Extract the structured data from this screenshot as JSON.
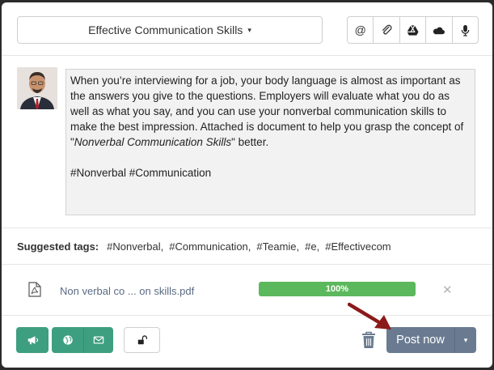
{
  "header": {
    "group_name": "Effective Communication Skills",
    "caret": "▾",
    "tools": [
      "at-icon",
      "paperclip-icon",
      "google-drive-icon",
      "onedrive-icon",
      "microphone-icon"
    ]
  },
  "post": {
    "text_before_italic": "When you’re interviewing for a job, your body language is almost as important as the answers you give to the questions. Employers will evaluate what you do as well as what you say, and you can use your nonverbal communication skills to make the best impression. Attached is document to help you grasp the concept of \"",
    "italic_text": "Nonverbal Communication Skills",
    "text_after_italic": "\" better.",
    "hashtags": "#Nonverbal #Communication"
  },
  "suggested_tags": {
    "label": "Suggested tags:",
    "tags": [
      "#Nonverbal,",
      "#Communication,",
      "#Teamie,",
      "#e,",
      "#Effectivecom"
    ]
  },
  "attachment": {
    "file_name": "Non verbal co ... on skills.pdf",
    "progress_label": "100%",
    "progress_value": 1.0,
    "remove": "✕"
  },
  "footer": {
    "post_label": "Post now",
    "caret": "▾"
  },
  "colors": {
    "green": "#3d9f7f",
    "post_button": "#6a7b91",
    "progress": "#5cb85c",
    "arrow": "#8b1a1a"
  }
}
